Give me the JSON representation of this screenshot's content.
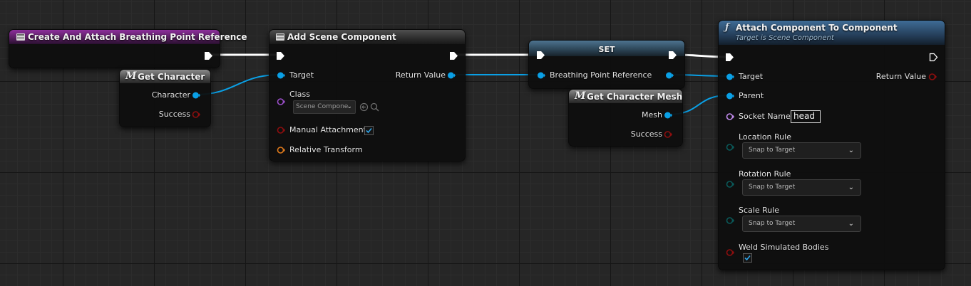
{
  "colors": {
    "exec": "#ffffff",
    "object_pin": "#0aa0e6",
    "class_pin": "#9a4ec8",
    "bool_pin": "#8e0e0e",
    "struct_pin": "#e07a1c",
    "enum_pin": "#0a5a5a",
    "name_pin": "#c38cf0"
  },
  "nodes": {
    "create_attach": {
      "title": "Create And Attach Breathing Point Reference",
      "icon": "event-graph-icon"
    },
    "get_character": {
      "title": "Get Character",
      "icon": "macro-icon",
      "outputs": {
        "character": "Character",
        "success": "Success"
      }
    },
    "add_scene_component": {
      "title": "Add Scene Component",
      "icon": "event-graph-icon",
      "inputs": {
        "target": "Target",
        "class": "Class",
        "class_value": "Scene Compone",
        "manual_attachment": "Manual Attachment",
        "manual_attachment_checked": true,
        "relative_transform": "Relative Transform"
      },
      "outputs": {
        "return_value": "Return Value"
      }
    },
    "set": {
      "title": "SET",
      "inputs": {
        "breathing_point_reference": "Breathing Point Reference"
      }
    },
    "get_character_mesh": {
      "title": "Get Character Mesh",
      "icon": "macro-icon",
      "outputs": {
        "mesh": "Mesh",
        "success": "Success"
      }
    },
    "attach_component": {
      "title": "Attach Component To Component",
      "subtitle": "Target is Scene Component",
      "icon": "function-icon",
      "inputs": {
        "target": "Target",
        "parent": "Parent",
        "socket_name": "Socket Name",
        "socket_name_value": "head",
        "location_rule": "Location Rule",
        "location_rule_value": "Snap to Target",
        "rotation_rule": "Rotation Rule",
        "rotation_rule_value": "Snap to Target",
        "scale_rule": "Scale Rule",
        "scale_rule_value": "Snap to Target",
        "weld_simulated_bodies": "Weld Simulated Bodies",
        "weld_checked": true
      },
      "outputs": {
        "return_value": "Return Value"
      }
    }
  }
}
